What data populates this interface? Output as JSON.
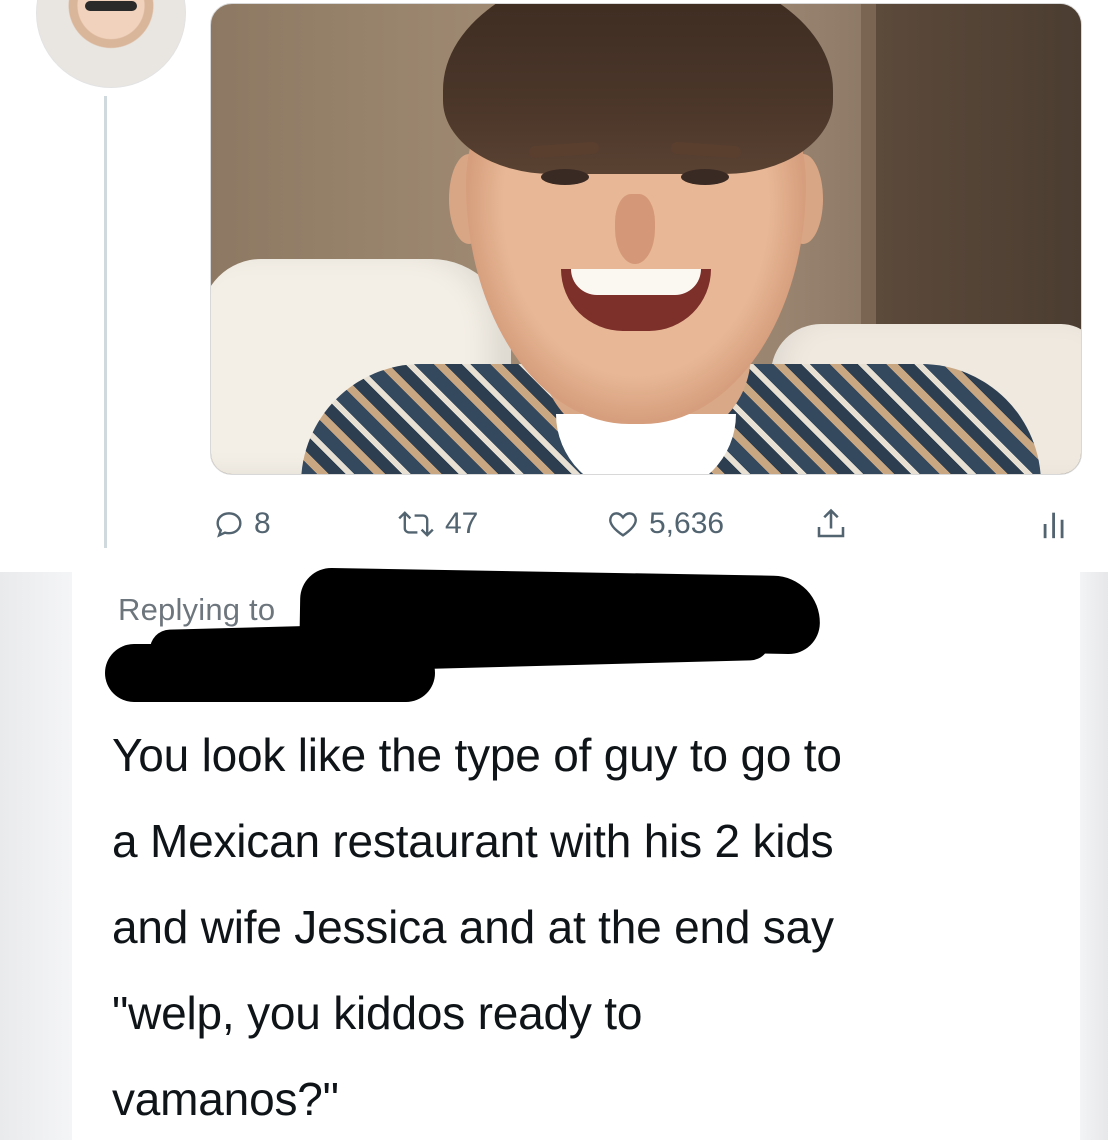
{
  "tweet": {
    "actions": {
      "reply_count": "8",
      "retweet_count": "47",
      "like_count": "5,636"
    },
    "icons": [
      "reply-icon",
      "retweet-icon",
      "like-icon",
      "share-icon",
      "analytics-icon"
    ]
  },
  "reply": {
    "replying_to": "Replying to",
    "lines": [
      "You look like the type of guy to go to",
      "a Mexican restaurant with his 2 kids",
      "and wife Jessica and at the end say",
      "\"welp, you kiddos ready to",
      "vamanos?\""
    ]
  },
  "colors": {
    "text": "#0f1419",
    "muted": "#536471",
    "thread_line": "#cfd9de"
  }
}
